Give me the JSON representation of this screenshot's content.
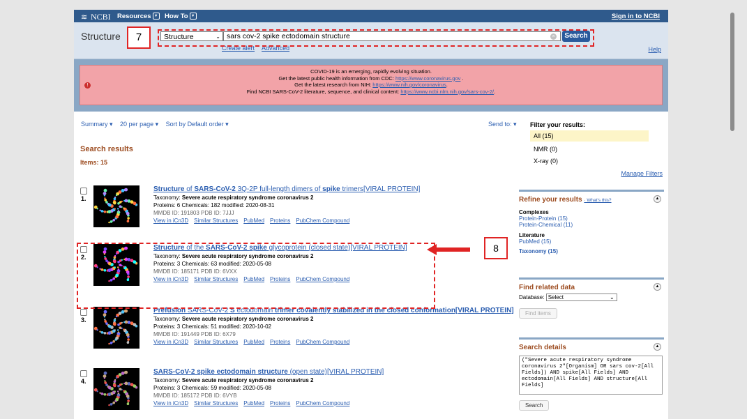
{
  "topbar": {
    "logo": "NCBI",
    "resources": "Resources",
    "howto": "How To",
    "signin": "Sign in to NCBI"
  },
  "search": {
    "db_title": "Structure",
    "db_select": "Structure",
    "term": "sars cov-2 spike ectodomain structure",
    "button": "Search",
    "create_alert": "Create alert",
    "advanced": "Advanced",
    "help": "Help"
  },
  "alert": {
    "line1": "COVID-19 is an emerging, rapidly evolving situation.",
    "line2_pre": "Get the latest public health information from CDC: ",
    "line2_link": "https://www.coronavirus.gov",
    "line2_post": " .",
    "line3_pre": "Get the latest research from NIH: ",
    "line3_link": "https://www.nih.gov/coronavirus",
    "line3_post": ".",
    "line4_pre": "Find NCBI SARS-CoV-2 literature, sequence, and clinical content: ",
    "line4_link": "https://www.ncbi.nlm.nih.gov/sars-cov-2/",
    "line4_post": "."
  },
  "toolbar": {
    "summary": "Summary ▾",
    "per_page": "20 per page ▾",
    "sort": "Sort by Default order ▾",
    "send_to": "Send to: ▾"
  },
  "results_header": {
    "title": "Search results",
    "items": "Items: 15"
  },
  "results": [
    {
      "num": "1.",
      "title_parts": [
        "Structure",
        " of ",
        "SARS-CoV-2",
        " 3Q-2P full-length dimers of ",
        "spike",
        " trimers[VIRAL PROTEIN]"
      ],
      "taxonomy_label": "Taxonomy: ",
      "taxonomy": "Severe acute respiratory syndrome coronavirus 2",
      "stats": "Proteins: 6   Chemicals: 182   modified: 2020-08-31",
      "ids": "MMDB ID: 191803   PDB ID: 7JJJ",
      "links": [
        "View in iCn3D",
        "Similar Structures",
        "PubMed",
        "Proteins",
        "PubChem Compound"
      ]
    },
    {
      "num": "2.",
      "title_parts": [
        "Structure",
        " of the ",
        "SARS-CoV-2",
        " ",
        "spike",
        " glycoprotein (closed state)[VIRAL PROTEIN]"
      ],
      "taxonomy_label": "Taxonomy: ",
      "taxonomy": "Severe acute respiratory syndrome coronavirus 2",
      "stats": "Proteins: 3   Chemicals: 63   modified: 2020-05-08",
      "ids": "MMDB ID: 185171   PDB ID: 6VXX",
      "links": [
        "View in iCn3D",
        "Similar Structures",
        "PubMed",
        "Proteins",
        "PubChem Compound"
      ]
    },
    {
      "num": "3.",
      "title_parts": [
        "Prefusion ",
        "SARS-CoV-2",
        " S ",
        "ectodomain",
        " trimer covalently stabilized in the closed conformation[VIRAL PROTEIN]",
        ""
      ],
      "taxonomy_label": "Taxonomy: ",
      "taxonomy": "Severe acute respiratory syndrome coronavirus 2",
      "stats": "Proteins: 3   Chemicals: 51   modified: 2020-10-02",
      "ids": "MMDB ID: 191449   PDB ID: 6X79",
      "links": [
        "View in iCn3D",
        "Similar Structures",
        "PubMed",
        "Proteins",
        "PubChem Compound"
      ]
    },
    {
      "num": "4.",
      "title_parts": [
        "",
        "",
        "SARS-CoV-2 spike ectodomain structure",
        " (open state)[VIRAL PROTEIN]",
        "",
        ""
      ],
      "taxonomy_label": "Taxonomy: ",
      "taxonomy": "Severe acute respiratory syndrome coronavirus 2",
      "stats": "Proteins: 3   Chemicals: 59   modified: 2020-05-08",
      "ids": "MMDB ID: 185172   PDB ID: 6VYB",
      "links": [
        "View in iCn3D",
        "Similar Structures",
        "PubMed",
        "Proteins",
        "PubChem Compound"
      ]
    }
  ],
  "sidebar": {
    "filter_title": "Filter your results:",
    "filters": [
      "All (15)",
      "NMR (0)",
      "X-ray (0)"
    ],
    "manage_filters": "Manage Filters",
    "refine_title": "Refine your results",
    "whats_this": "· What's this?",
    "complexes_head": "Complexes",
    "complexes": [
      "Protein-Protein (15)",
      "Protein-Chemical (11)"
    ],
    "literature_head": "Literature",
    "literature": [
      "PubMed (15)"
    ],
    "taxonomy_link": "Taxonomy (15)",
    "related_title": "Find related data",
    "database_label": "Database:",
    "database_select": "Select",
    "find_items": "Find items",
    "details_title": "Search details",
    "details_text": "(\"Severe acute respiratory syndrome coronavirus 2\"[Organism] OR sars cov-2[All Fields]) AND spike[All Fields] AND ectodomain[All Fields] AND structure[All Fields]",
    "details_search": "Search"
  },
  "annotations": {
    "label_7": "7",
    "label_8": "8",
    "color": "#e02424"
  }
}
